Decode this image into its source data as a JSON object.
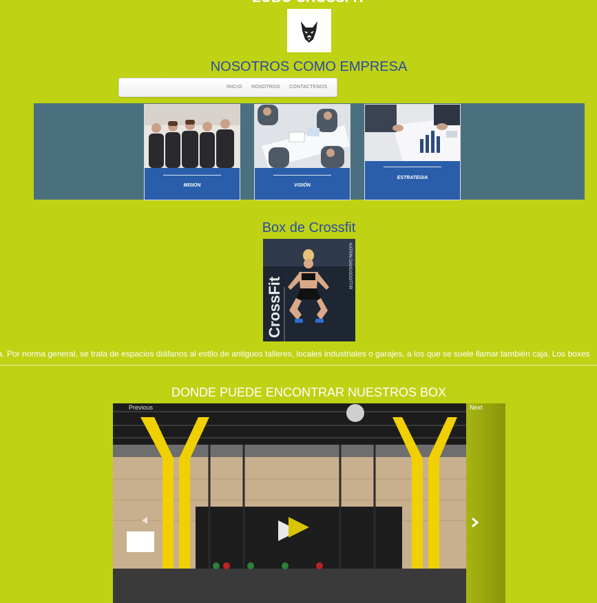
{
  "site": {
    "title": "LOBO CROSSFIT"
  },
  "company": {
    "heading": "NOSOTROS COMO EMPRESA"
  },
  "nav": {
    "items": [
      {
        "label": "INICIO"
      },
      {
        "label": "NOSOTROS"
      },
      {
        "label": "CONTACTENOS"
      }
    ]
  },
  "cards": [
    {
      "label": "MISION"
    },
    {
      "label": "VISIÓN"
    },
    {
      "label": "ESTRATEGIA"
    }
  ],
  "box": {
    "heading": "Box de Crossfit",
    "poster_text": "CrossFit",
    "poster_side": "KATRIN DAVIDSDOTTIR"
  },
  "ticker": {
    "text": "na. Por norma general, se trata de espacios diáfanos al estilo de antiguos talleres, locales industriales o garajes, a los que se suele llamar también caja. Los boxes"
  },
  "locations": {
    "heading": "DONDE PUEDE ENCONTRAR NUESTROS BOX"
  },
  "carousel": {
    "previous_label": "Previous",
    "next_label": "Next"
  },
  "colors": {
    "background": "#bfd214",
    "heading_blue": "#2b4aa6",
    "band": "#4a7080",
    "card_caption": "#2a5eab"
  }
}
